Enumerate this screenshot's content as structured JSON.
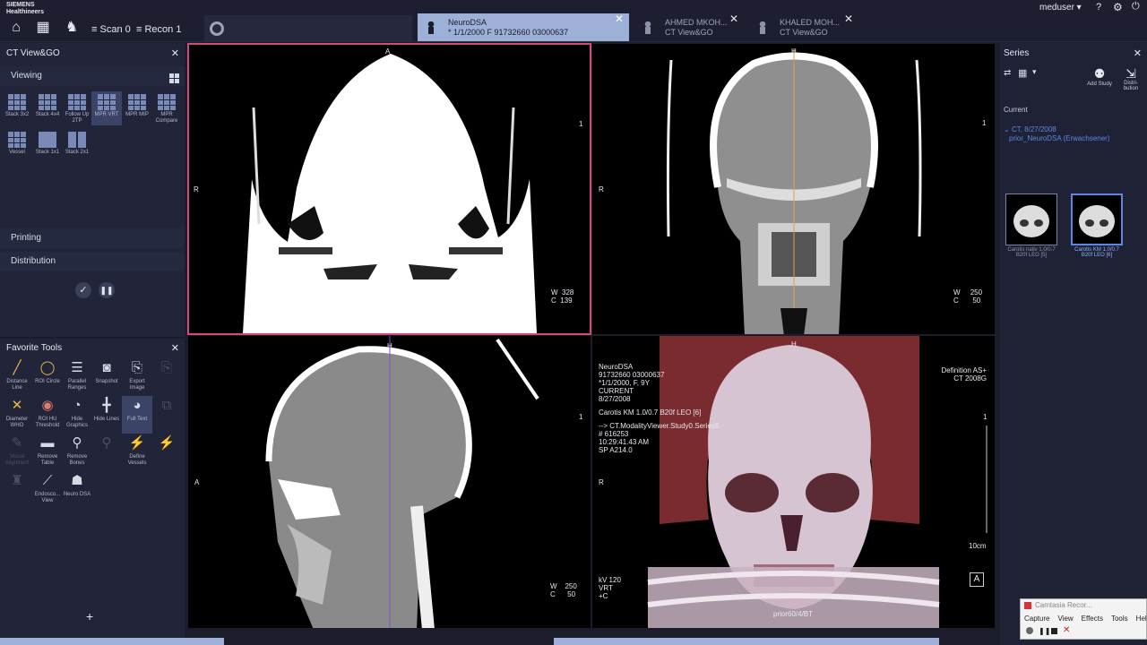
{
  "brand": {
    "line1": "SIEMENS",
    "line2": "Healthineers"
  },
  "topbar": {
    "scan_label": "Scan",
    "scan_count": "0",
    "recon_label": "Recon",
    "recon_count": "1",
    "user": "meduser",
    "help": "?"
  },
  "tabs": [
    {
      "line1": "NeuroDSA",
      "line2": "* 1/1/2000 F 91732660    03000637",
      "close": "✕"
    },
    {
      "line1": "AHMED MKOH...",
      "line2": "CT View&GO",
      "close": "✕"
    },
    {
      "line1": "KHALED MOH...",
      "line2": "CT View&GO",
      "close": "✕"
    }
  ],
  "left_panel": {
    "title": "CT View&GO",
    "close": "✕",
    "viewing_label": "Viewing",
    "layouts": [
      {
        "label": "Stack 3x2"
      },
      {
        "label": "Stack 4x4"
      },
      {
        "label": "Follow Up 2TP"
      },
      {
        "label": "MPR VRT"
      },
      {
        "label": "MPR MIP"
      },
      {
        "label": "MPR Compare"
      },
      {
        "label": "Vessel"
      },
      {
        "label": "Stack 1x1"
      },
      {
        "label": "Stack 2x1"
      }
    ],
    "printing_label": "Printing",
    "distribution_label": "Distribution"
  },
  "favorite_tools": {
    "title": "Favorite Tools",
    "close": "✕",
    "add": "+",
    "tools": [
      {
        "label": "Distance Line",
        "icon": "ruler-icon"
      },
      {
        "label": "ROI Circle",
        "icon": "circle-icon"
      },
      {
        "label": "Parallel Ranges",
        "icon": "ranges-icon"
      },
      {
        "label": "Snapshot",
        "icon": "camera-icon"
      },
      {
        "label": "Export Image",
        "icon": "export-icon"
      },
      {
        "label": "Diameter WHO",
        "icon": "diameter-icon"
      },
      {
        "label": "ROI HU Threshold",
        "icon": "threshold-icon"
      },
      {
        "label": "Hide Graphics",
        "icon": "hide-graphics-icon"
      },
      {
        "label": "Hide Lines",
        "icon": "crosshair-icon"
      },
      {
        "label": "Full Text",
        "icon": "text-icon"
      },
      {
        "label": "Visual Alignment",
        "icon": "alignment-icon"
      },
      {
        "label": "Remove Table",
        "icon": "remove-table-icon"
      },
      {
        "label": "Remove Bones",
        "icon": "remove-bones-icon"
      },
      {
        "label": "Define Vessels",
        "icon": "vessel-icon"
      },
      {
        "label": "Endosco... View",
        "icon": "endoscopy-icon"
      },
      {
        "label": "Neuro DSA",
        "icon": "neuro-dsa-icon"
      }
    ]
  },
  "viewports": {
    "axial": {
      "orient_top": "A",
      "orient_left": "R",
      "slice": "1",
      "w_label": "W",
      "w_value": "328",
      "c_label": "C",
      "c_value": "139"
    },
    "coronal": {
      "orient_top": "H",
      "orient_left": "R",
      "slice": "1",
      "w_label": "W",
      "w_value": "250",
      "c_label": "C",
      "c_value": "50"
    },
    "sagittal": {
      "orient_top": "H",
      "orient_left": "A",
      "slice": "1",
      "w_label": "W",
      "w_value": "250",
      "c_label": "C",
      "c_value": "50"
    },
    "vrt": {
      "orient_top": "H",
      "orient_left": "R",
      "info_lines": [
        "NeuroDSA",
        "91732660    03000637",
        "*1/1/2000, F, 9Y",
        "CURRENT",
        "8/27/2008",
        "",
        "Carotis KM  1.0/0.7  B20f LEO [6]",
        "",
        "--> CT.ModalityViewer.Study0.Series6",
        "# 616253",
        "10:29:41.43 AM",
        "SP A214.0"
      ],
      "scanner_lines": [
        "Definition AS+",
        "CT 2008G"
      ],
      "slice": "1",
      "scale": "10cm",
      "kv_lines": [
        "kV 120",
        "VRT",
        "+C"
      ],
      "preset": "prior60/4/BT",
      "annotation_icon": "A"
    }
  },
  "series_panel": {
    "title": "Series",
    "close": "✕",
    "add_study": "Add Study",
    "distribution": "Distri-bution",
    "current_label": "Current",
    "study_line1": "CT, 8/27/2008",
    "study_line2": "prior_NeuroDSA (Erwachsener)",
    "thumbs": [
      {
        "line1": "Carotis nativ  1.0/0.7",
        "line2": "B20f LEO [5]"
      },
      {
        "line1": "Carotis KM  1.0/0.7",
        "line2": "B20f LEO [6]"
      }
    ]
  },
  "camtasia": {
    "title": "Camtasia Recor...",
    "menu": [
      "Capture",
      "View",
      "Effects",
      "Tools",
      "Hel"
    ]
  }
}
